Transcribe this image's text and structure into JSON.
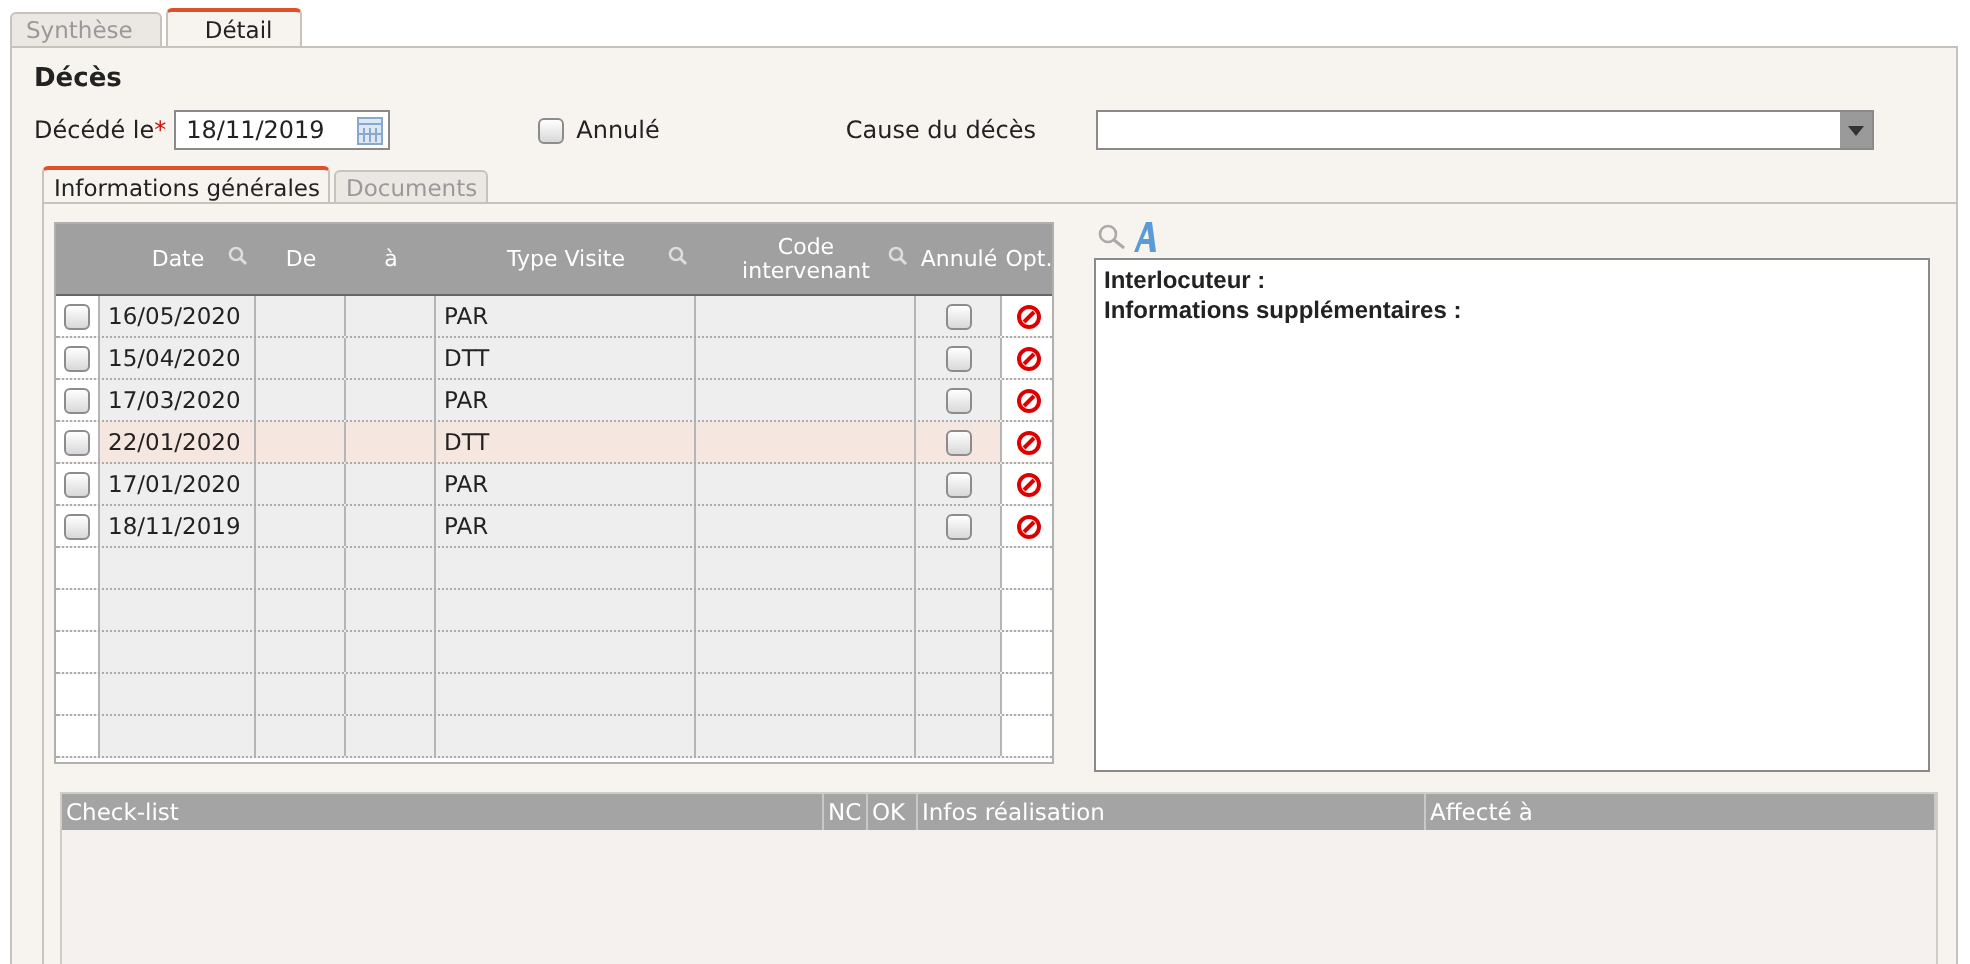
{
  "tabs": [
    {
      "label": "Synthèse",
      "selected": false
    },
    {
      "label": "Détail",
      "selected": true
    }
  ],
  "section_title": "Décès",
  "deceased_field": {
    "label": "Décédé le",
    "required_mark": "*",
    "value": "18/11/2019"
  },
  "cancelled_checkbox": {
    "label": "Annulé",
    "checked": false
  },
  "cause_field": {
    "label": "Cause du décès"
  },
  "inner_tabs": [
    {
      "label": "Informations générales",
      "selected": true
    },
    {
      "label": "Documents",
      "selected": false
    }
  ],
  "visits_table": {
    "columns": [
      {
        "label": "Date",
        "search": true
      },
      {
        "label": "De",
        "search": false
      },
      {
        "label": "à",
        "search": false
      },
      {
        "label": "Type Visite",
        "search": true
      },
      {
        "label": "Code intervenant",
        "search": true
      },
      {
        "label": "Annulé",
        "search": false
      },
      {
        "label": "Opt.",
        "search": false
      }
    ],
    "rows": [
      {
        "checked": false,
        "date": "16/05/2020",
        "type": "PAR",
        "cancelled": false,
        "selected": false
      },
      {
        "checked": false,
        "date": "15/04/2020",
        "type": "DTT",
        "cancelled": false,
        "selected": false
      },
      {
        "checked": false,
        "date": "17/03/2020",
        "type": "PAR",
        "cancelled": false,
        "selected": false
      },
      {
        "checked": false,
        "date": "22/01/2020",
        "type": "DTT",
        "cancelled": false,
        "selected": true
      },
      {
        "checked": false,
        "date": "17/01/2020",
        "type": "PAR",
        "cancelled": false,
        "selected": false
      },
      {
        "checked": false,
        "date": "18/11/2019",
        "type": "PAR",
        "cancelled": false,
        "selected": false
      }
    ]
  },
  "notes": {
    "lines": [
      "Interlocuteur :",
      "Informations supplémentaires :"
    ]
  },
  "checklist_table": {
    "columns": [
      "Check-list",
      "NC",
      "OK",
      "Infos réalisation",
      "Affecté à"
    ]
  }
}
